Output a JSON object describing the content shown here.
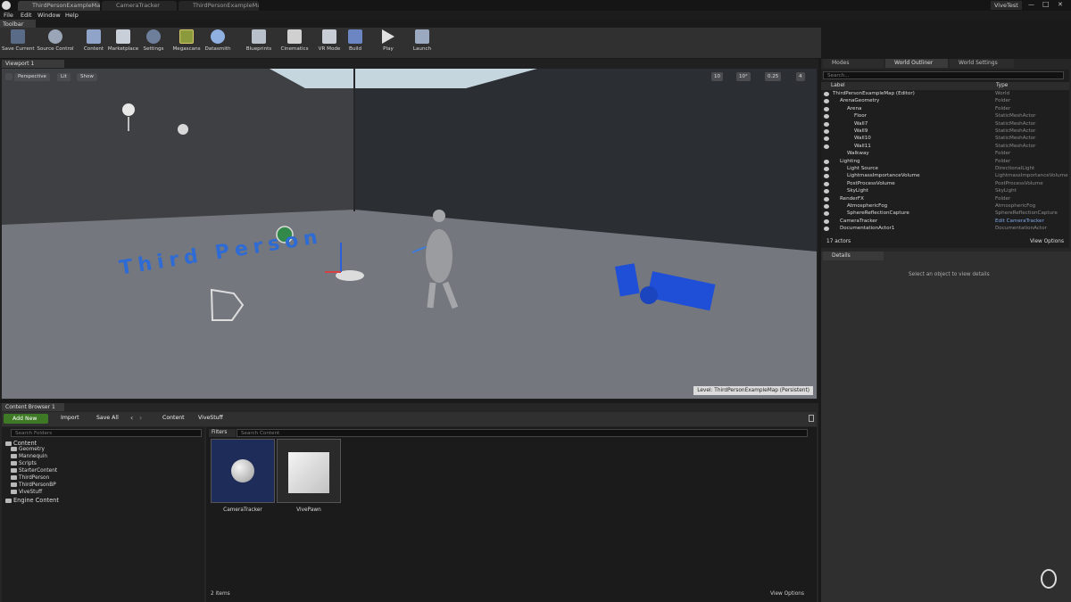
{
  "window": {
    "tabs": [
      "ThirdPersonExampleMap",
      "CameraTracker",
      "ThirdPersonExampleMap"
    ],
    "project_name": "ViveTest",
    "controls": [
      "—",
      "□",
      "✕"
    ]
  },
  "menu": [
    "File",
    "Edit",
    "Window",
    "Help"
  ],
  "toolbar": {
    "tab_label": "Toolbar",
    "buttons": [
      "Save Current",
      "Source Control",
      "Content",
      "Marketplace",
      "Settings",
      "Megascans",
      "Datasmith",
      "Blueprints",
      "Cinematics",
      "VR Mode",
      "Build",
      "Play",
      "Launch"
    ]
  },
  "viewport": {
    "tab_label": "Viewport 1",
    "perspective": "Perspective",
    "lit": "Lit",
    "show": "Show",
    "snap_values": [
      "10",
      "10°",
      "0.25",
      "4"
    ],
    "level_text": "Level:  ThirdPersonExampleMap (Persistent)",
    "floor_text": "Third Person"
  },
  "right_tabs": [
    "Modes",
    "World Outliner",
    "World Settings"
  ],
  "outliner": {
    "search_placeholder": "Search...",
    "col_label": "Label",
    "col_type": "Type",
    "rows": [
      {
        "label": "ThirdPersonExampleMap (Editor)",
        "type": "World"
      },
      {
        "label": "ArenaGeometry",
        "type": "Folder"
      },
      {
        "label": "Arena",
        "type": "Folder"
      },
      {
        "label": "Floor",
        "type": "StaticMeshActor"
      },
      {
        "label": "Wall7",
        "type": "StaticMeshActor"
      },
      {
        "label": "Wall9",
        "type": "StaticMeshActor"
      },
      {
        "label": "Wall10",
        "type": "StaticMeshActor"
      },
      {
        "label": "Wall11",
        "type": "StaticMeshActor"
      },
      {
        "label": "Walkway",
        "type": "Folder"
      },
      {
        "label": "Lighting",
        "type": "Folder"
      },
      {
        "label": "Light Source",
        "type": "DirectionalLight"
      },
      {
        "label": "LightmassImportanceVolume",
        "type": "LightmassImportanceVolume"
      },
      {
        "label": "PostProcessVolume",
        "type": "PostProcessVolume"
      },
      {
        "label": "SkyLight",
        "type": "SkyLight"
      },
      {
        "label": "RenderFX",
        "type": "Folder"
      },
      {
        "label": "AtmosphericFog",
        "type": "AtmosphericFog"
      },
      {
        "label": "SphereReflectionCapture",
        "type": "SphereReflectionCapture"
      },
      {
        "label": "CameraTracker",
        "type": "Edit CameraTracker"
      },
      {
        "label": "DocumentationActor1",
        "type": "DocumentationActor"
      }
    ],
    "actor_count": "17 actors",
    "view_options": "View Options"
  },
  "details": {
    "tab_label": "Details",
    "empty_text": "Select an object to view details"
  },
  "content_browser": {
    "tab_label": "Content Browser 1",
    "add_new": "Add New",
    "import": "Import",
    "save_all": "Save All",
    "path": [
      "Content",
      "ViveStuff"
    ],
    "search_folders": "Search Folders",
    "filters": "Filters",
    "search_content": "Search Content",
    "tree": [
      {
        "label": "Content",
        "level": 0
      },
      {
        "label": "Geometry",
        "level": 1
      },
      {
        "label": "Mannequin",
        "level": 1
      },
      {
        "label": "Scripts",
        "level": 1
      },
      {
        "label": "StarterContent",
        "level": 1
      },
      {
        "label": "ThirdPerson",
        "level": 1
      },
      {
        "label": "ThirdPersonBP",
        "level": 1
      },
      {
        "label": "ViveStuff",
        "level": 1
      },
      {
        "label": "Engine Content",
        "level": 0
      }
    ],
    "assets": [
      "CameraTracker",
      "VivePawn"
    ],
    "item_count": "2 items",
    "view_options": "View Options"
  },
  "colors": {
    "accent": "#1f4fd6",
    "add_new": "#3e7a26",
    "selected_asset": "#1e2c5a"
  }
}
